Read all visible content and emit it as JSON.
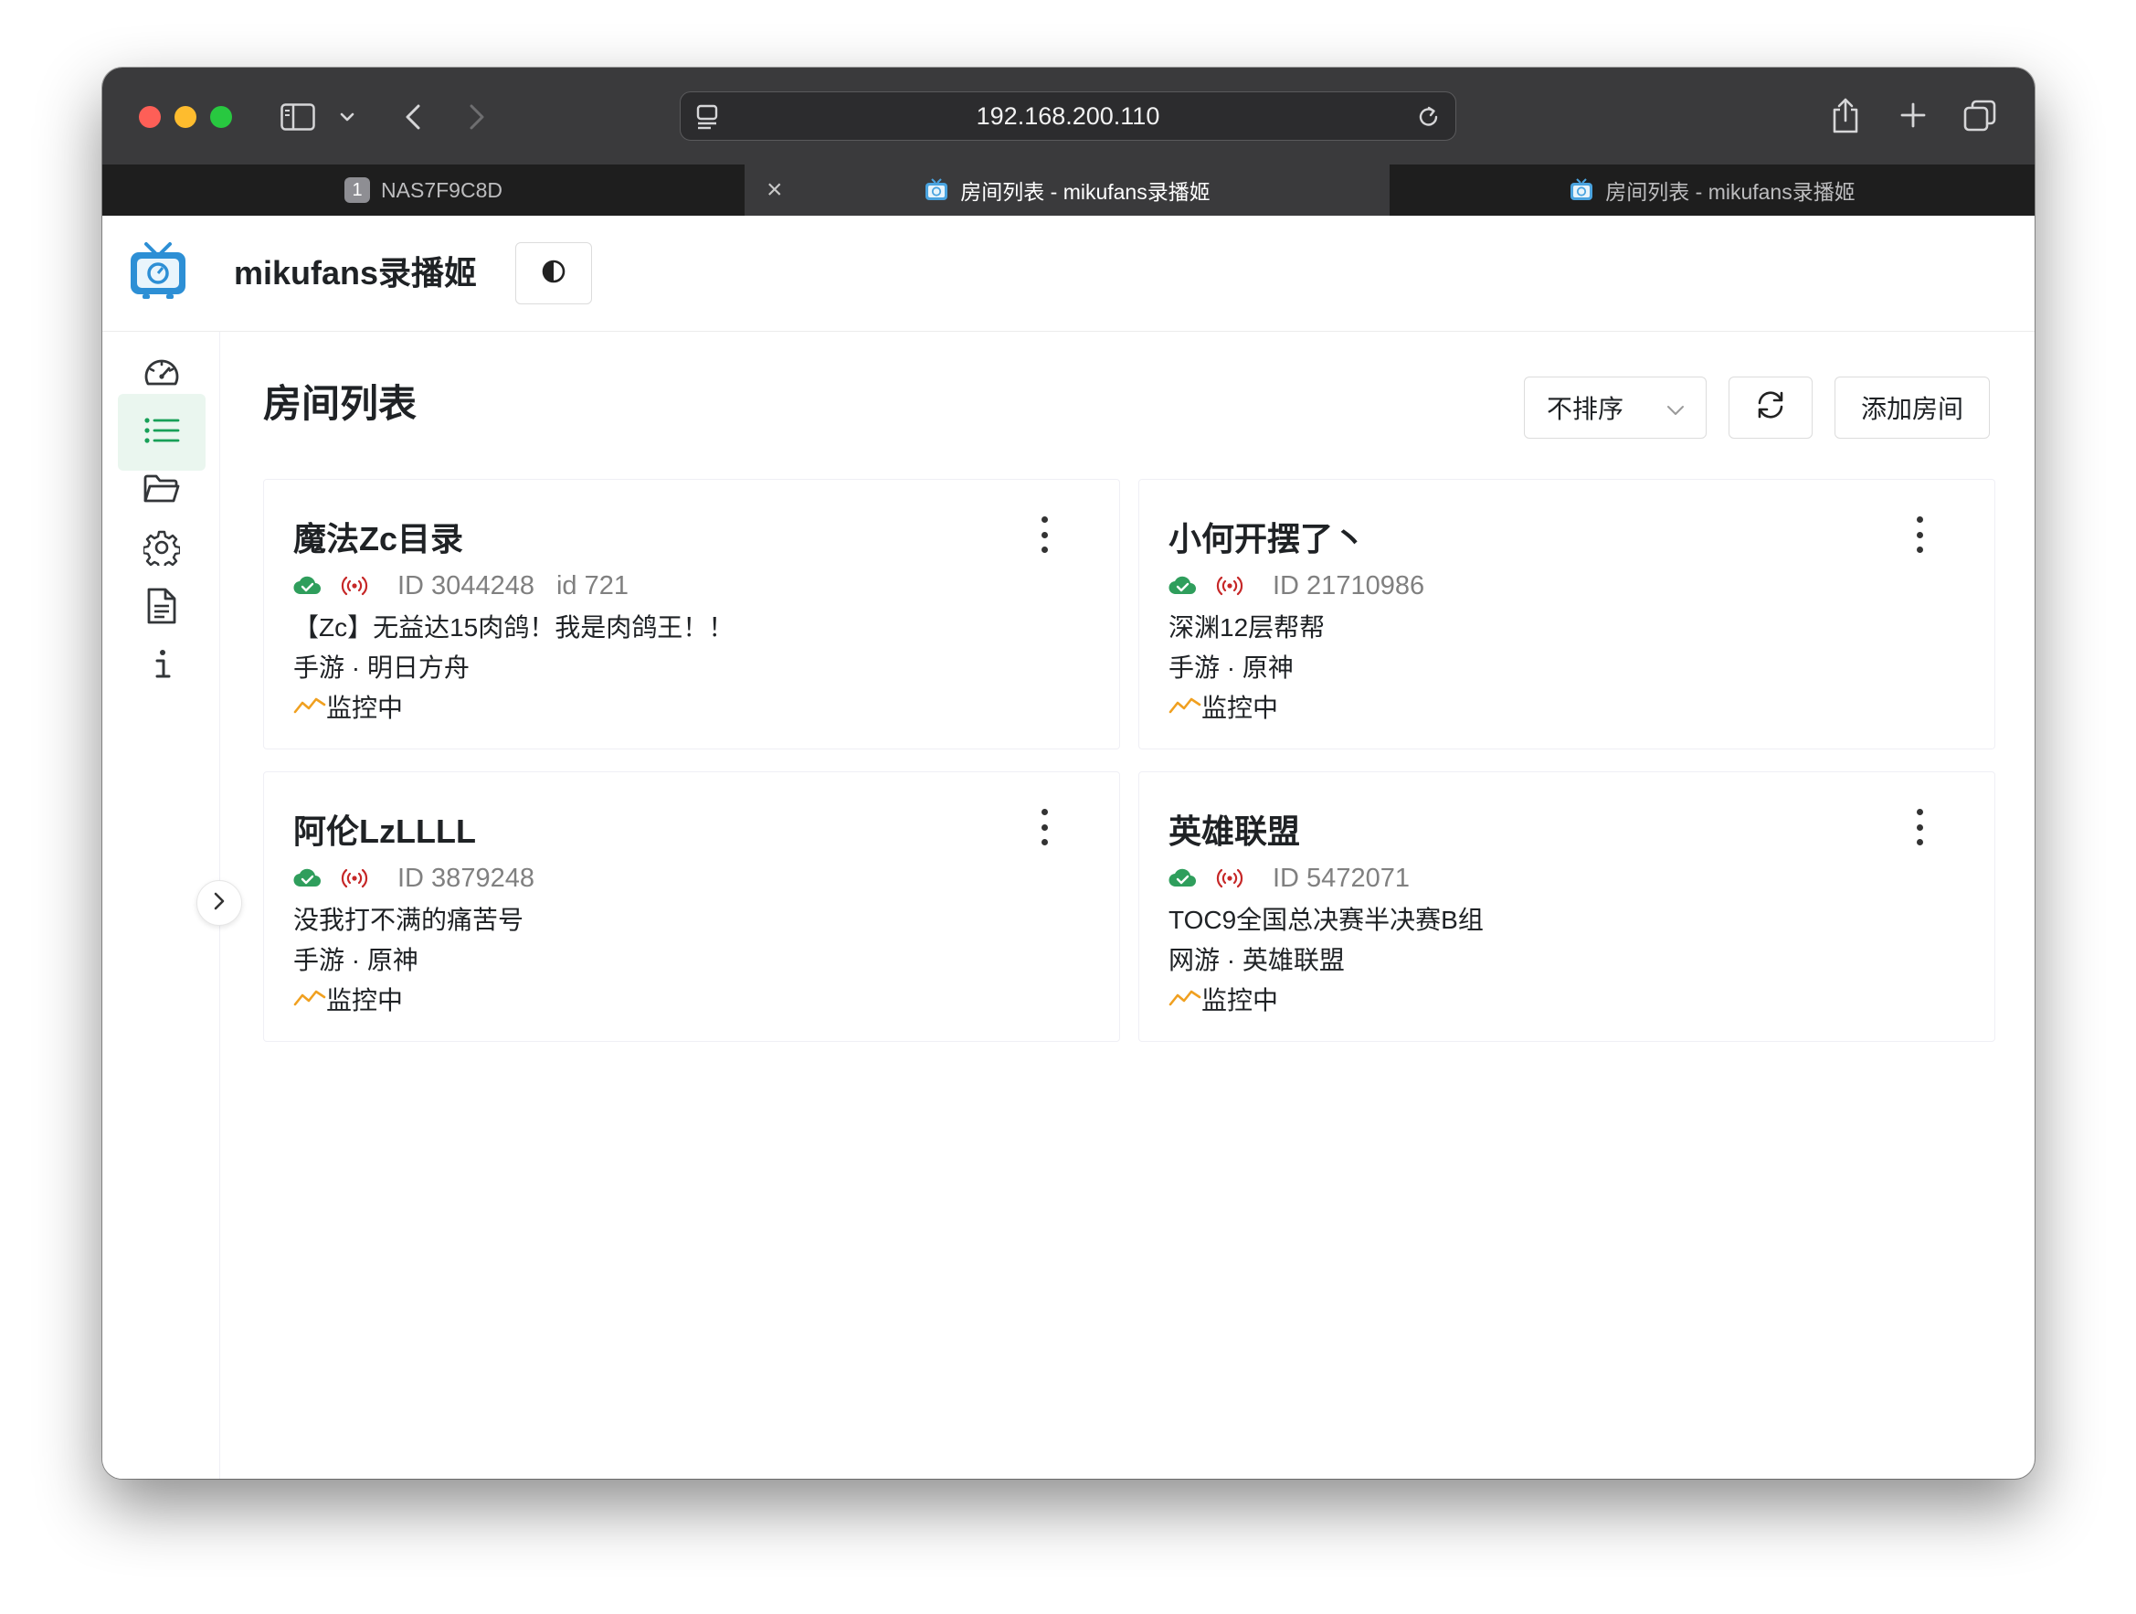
{
  "browser": {
    "url": "192.168.200.110",
    "tabs": [
      {
        "label": "NAS7F9C8D",
        "badge": "1"
      },
      {
        "label": "房间列表 - mikufans录播姬",
        "close": "×"
      },
      {
        "label": "房间列表 - mikufans录播姬"
      }
    ]
  },
  "app": {
    "name": "mikufans录播姬",
    "accent": "#18a058"
  },
  "page": {
    "title": "房间列表",
    "sort_label": "不排序",
    "add_label": "添加房间"
  },
  "rooms": [
    {
      "title": "魔法Zc目录",
      "id_text": "ID 3044248",
      "short_id_text": "id 721",
      "live_title": "【Zc】无益达15肉鸽！我是肉鸽王！！",
      "area": "手游 · 明日方舟",
      "status": "监控中"
    },
    {
      "title": "小何开摆了丶",
      "id_text": "ID 21710986",
      "short_id_text": "",
      "live_title": "深渊12层帮帮",
      "area": "手游 · 原神",
      "status": "监控中"
    },
    {
      "title": "阿伦LzLLLL",
      "id_text": "ID 3879248",
      "short_id_text": "",
      "live_title": "没我打不满的痛苦号",
      "area": "手游 · 原神",
      "status": "监控中"
    },
    {
      "title": "英雄联盟",
      "id_text": "ID 5472071",
      "short_id_text": "",
      "live_title": "TOC9全国总决赛半决赛B组",
      "area": "网游 · 英雄联盟",
      "status": "监控中"
    }
  ]
}
